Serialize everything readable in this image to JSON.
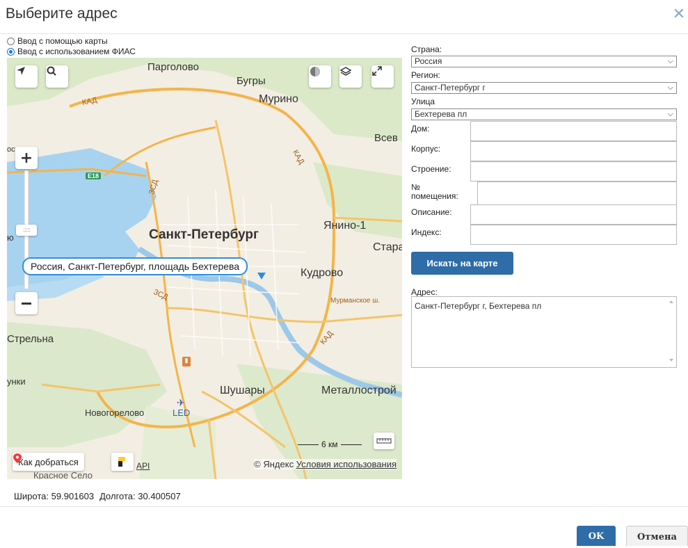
{
  "dialog": {
    "title": "Выберите адрес"
  },
  "mode": {
    "options": [
      {
        "label": "Ввод с помощью карты",
        "selected": false
      },
      {
        "label": "Ввод с использованием ФИАС",
        "selected": true
      }
    ]
  },
  "map": {
    "labels": {
      "pargolovo": "Парголово",
      "bugry": "Бугры",
      "murino": "Мурино",
      "vsevolozhsk": "Всев",
      "spb": "Санкт-Петербург",
      "yanino": "Янино-1",
      "stara": "Стара",
      "kudrovo": "Кудрово",
      "strelna": "Стрельна",
      "shushary": "Шушары",
      "metallostroy": "Металлострой",
      "novogorelovo": "Новогорелово",
      "led": "LED",
      "kad1": "КАД",
      "kad2": "КАД",
      "kad3": "КАД",
      "zsd1": "ЗСД",
      "zsd2": "ЗСД",
      "e18": "E18",
      "murm": "Мурманское ш.",
      "unki": "унки",
      "yus": "ю",
      "krasnoe": "Красное Село",
      "os": "ос"
    },
    "bubble_text": "Россия, Санкт-Петербург, площадь Бехтерева",
    "route_label": "Как добраться",
    "api_label": "API",
    "copyright": "© Яндекс",
    "terms_link": "Условия использования",
    "scale_label": "6 км"
  },
  "coords": {
    "lat_label": "Широта:",
    "lat_value": "59.901603",
    "lon_label": "Долгота:",
    "lon_value": "30.400507"
  },
  "form": {
    "country_label": "Страна:",
    "country_value": "Россия",
    "region_label": "Регион:",
    "region_value": "Санкт-Петербург г",
    "street_label": "Улица",
    "street_value": "Бехтерева пл",
    "house_label": "Дом:",
    "building_label": "Корпус:",
    "structure_label": "Строение:",
    "room_label_1": "№",
    "room_label_2": "помещения:",
    "description_label": "Описание:",
    "index_label": "Индекс:",
    "search_button": "Искать на карте",
    "address_label": "Адрес:",
    "address_value": "Санкт-Петербург г, Бехтерева пл"
  },
  "footer": {
    "ok": "OK",
    "cancel": "Отмена"
  }
}
